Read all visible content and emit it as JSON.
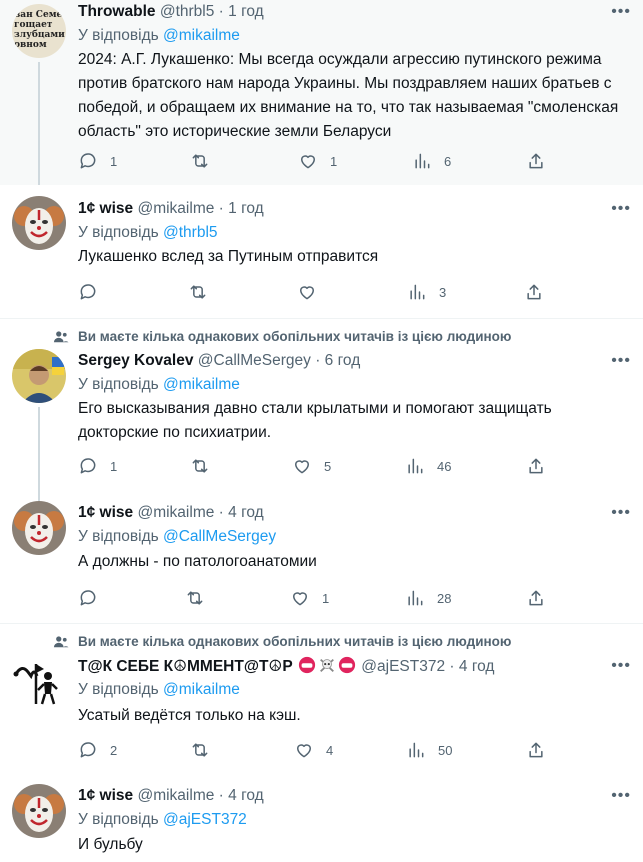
{
  "labels": {
    "reply_prefix": "У відповідь",
    "social_context": "Ви маєте кілька однакових обопільних читачів із цією людиною"
  },
  "tweets": [
    {
      "name": "Throwable",
      "handle": "@thrbl5",
      "time": "1 год",
      "reply_to": "@mikailme",
      "text": "2024: А.Г. Лукашенко: Мы всегда осуждали агрессию путинского режима против братского нам народа Украины. Мы поздравляем наших братьев с победой, и обращаем их внимание на то, что так называемая \"смоленская область\" это исторические земли Беларуси",
      "avatar_text": "ван Семе гощает злубцами овном",
      "replies": "1",
      "retweets": "",
      "likes": "1",
      "views": "6"
    },
    {
      "name": "1¢ wise",
      "handle": "@mikailme",
      "time": "1 год",
      "reply_to": "@thrbl5",
      "text": "Лукашенко вслед за Путиным отправится",
      "replies": "",
      "retweets": "",
      "likes": "",
      "views": "3"
    },
    {
      "name": "Sergey Kovalev",
      "handle": "@CallMeSergey",
      "time": "6 год",
      "reply_to": "@mikailme",
      "text": "Его высказывания давно стали крылатыми и помогают защищать докторские по психиатрии.",
      "replies": "1",
      "retweets": "",
      "likes": "5",
      "views": "46"
    },
    {
      "name": "1¢ wise",
      "handle": "@mikailme",
      "time": "4 год",
      "reply_to": "@CallMeSergey",
      "text": "А должны - по патологоанатомии",
      "replies": "",
      "retweets": "",
      "likes": "1",
      "views": "28"
    },
    {
      "name": "Т@К СЕБЕ К☮ММЕНТ@Т☮Р",
      "handle": "@ajEST372",
      "time": "4 год",
      "reply_to": "@mikailme",
      "text": "Усатый ведётся только на кэш.",
      "replies": "2",
      "retweets": "",
      "likes": "4",
      "views": "50"
    },
    {
      "name": "1¢ wise",
      "handle": "@mikailme",
      "time": "4 год",
      "reply_to": "@ajEST372",
      "text": "И бульбу"
    }
  ],
  "colors": {
    "accent": "#1d9bf0",
    "muted": "#536471",
    "highlight_bg": "#f7f9f9"
  }
}
